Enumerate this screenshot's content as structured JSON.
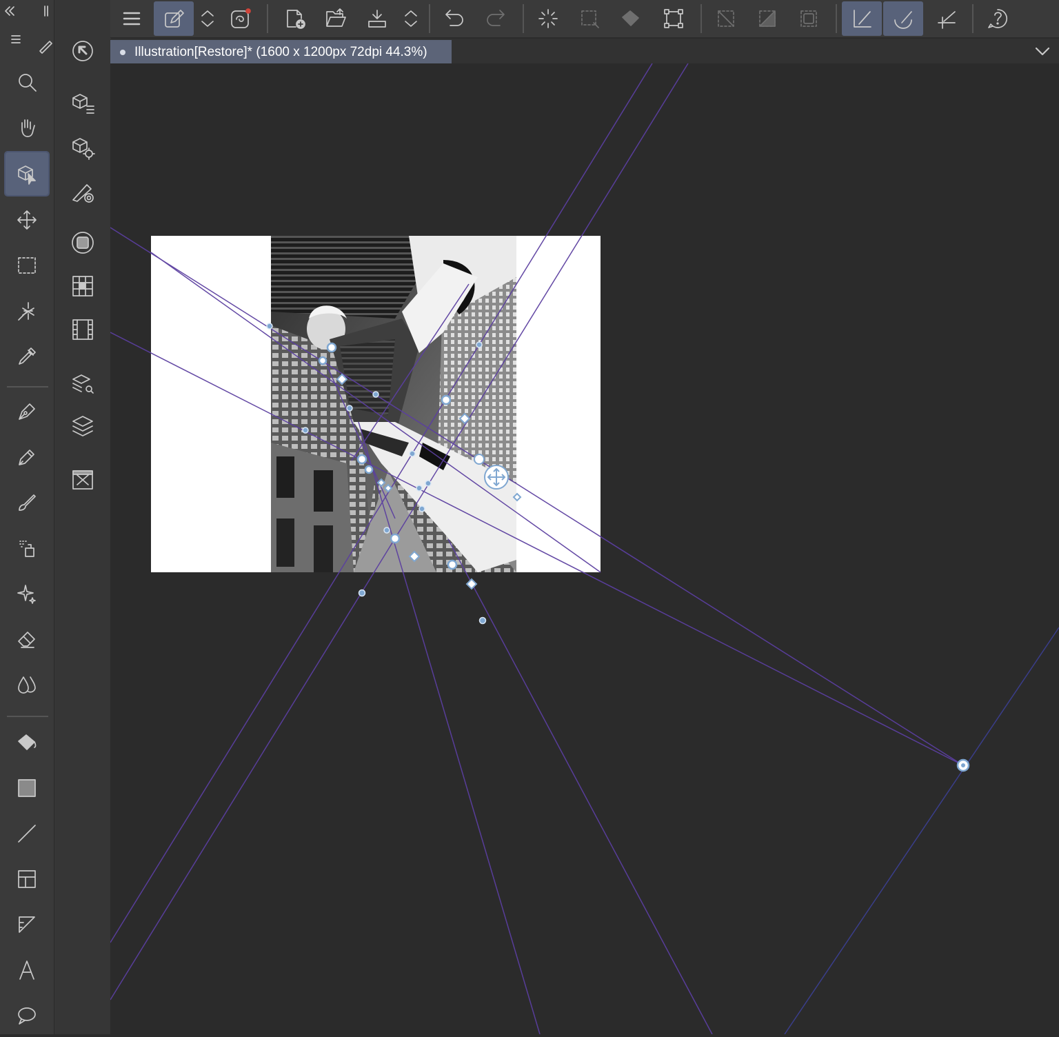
{
  "app": {
    "accent": "#58627a",
    "guide_color": "#5b3fa0",
    "handle_color": "#8fb1d6"
  },
  "document_tab": {
    "title": "Illustration[Restore]* (1600 x 1200px 72dpi 44.3%)"
  },
  "left_toolbar": {
    "tools": [
      "zoom-icon",
      "hand-icon",
      "object-tool-icon",
      "move-icon",
      "marquee-selection-icon",
      "auto-select-icon",
      "eyedropper-icon",
      "pen-icon",
      "pencil-icon",
      "brush-icon",
      "airbrush-icon",
      "decoration-icon",
      "eraser-icon",
      "blend-icon",
      "fill-icon",
      "gradient-icon",
      "figure-line-icon",
      "frame-border-icon",
      "ruler-icon",
      "text-icon",
      "balloon-icon"
    ],
    "active_tool": "object-tool-icon"
  },
  "sub_toolbar": {
    "tools": [
      "operation-icon",
      "3d-object-list-icon",
      "3d-object-settings-icon",
      "light-table-icon",
      "layer-property-icon",
      "navigator-icon",
      "animation-timeline-icon",
      "layer-search-icon",
      "layers-icon",
      "material-icon"
    ]
  },
  "command_bar": {
    "buttons": [
      "menu-icon",
      "edit-companion-icon",
      "switch-icon",
      "smartphone-companion-icon",
      "new-document-icon",
      "open-icon",
      "save-icon",
      "save-switch-icon",
      "undo-icon",
      "redo-icon",
      "loading-spinner-icon",
      "selection-launcher-icon",
      "fill-bucket-icon",
      "transform-icon",
      "clear-selection-icon",
      "invert-selection-icon",
      "selection-border-icon",
      "snap-to-ruler-icon",
      "snap-to-special-ruler-icon",
      "snap-to-grid-icon",
      "help-icon"
    ]
  }
}
